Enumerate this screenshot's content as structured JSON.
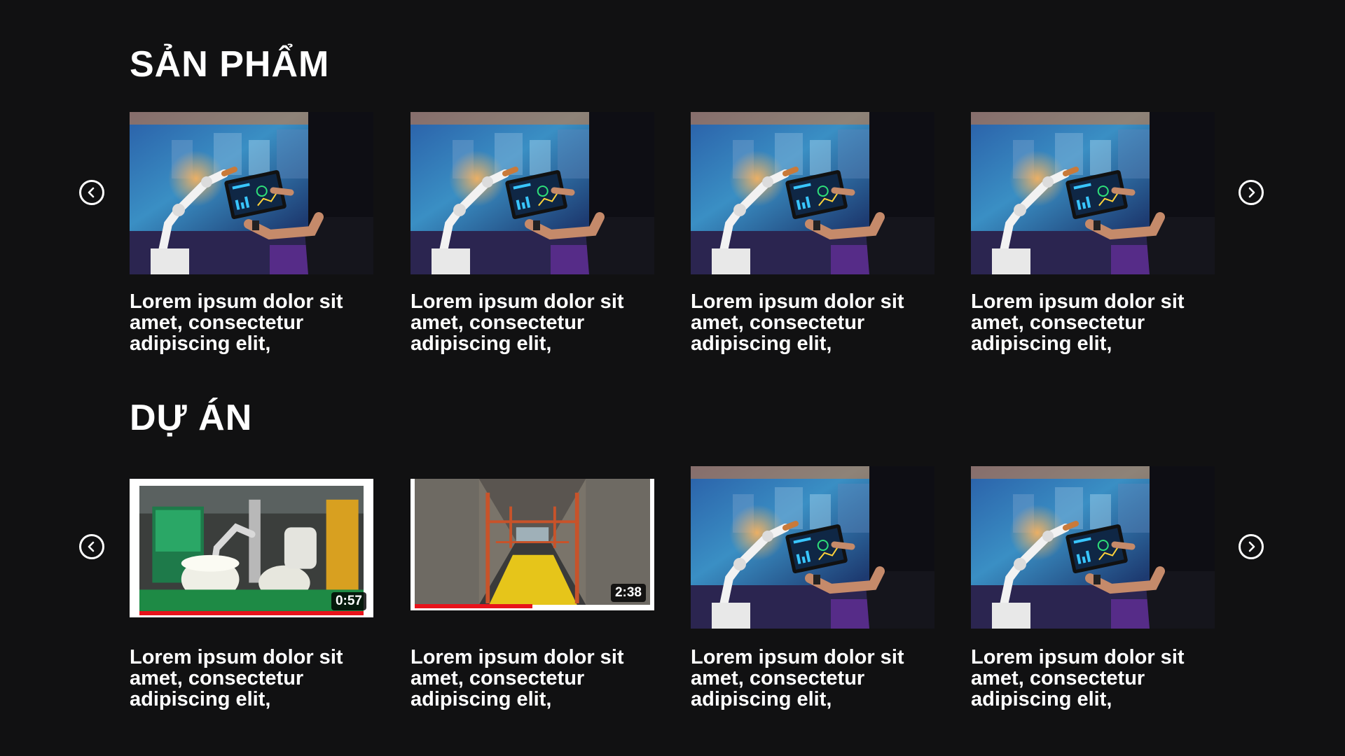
{
  "sections": [
    {
      "title": "SẢN PHẨM",
      "cards": [
        {
          "caption": "Lorem ipsum dolor sit amet, consectetur adipiscing elit,",
          "image": "robot-arm-tablet-photo"
        },
        {
          "caption": "Lorem ipsum dolor sit amet, consectetur adipiscing elit,",
          "image": "robot-arm-tablet-photo"
        },
        {
          "caption": "Lorem ipsum dolor sit amet, consectetur adipiscing elit,",
          "image": "robot-arm-tablet-photo"
        },
        {
          "caption": "Lorem ipsum dolor sit amet, consectetur adipiscing elit,",
          "image": "robot-arm-tablet-photo"
        }
      ]
    },
    {
      "title": "DỰ ÁN",
      "cards": [
        {
          "caption": "Lorem ipsum dolor sit amet, consectetur adipiscing elit,",
          "image": "factory-robot-video",
          "duration": "0:57",
          "progress": 1.0
        },
        {
          "caption": "Lorem ipsum dolor sit amet, consectetur adipiscing elit,",
          "image": "warehouse-aisle-video",
          "duration": "2:38",
          "progress": 0.5
        },
        {
          "caption": "Lorem ipsum dolor sit amet, consectetur adipiscing elit,",
          "image": "robot-arm-tablet-photo"
        },
        {
          "caption": "Lorem ipsum dolor sit amet, consectetur adipiscing elit,",
          "image": "robot-arm-tablet-photo"
        }
      ]
    }
  ],
  "icons": {
    "prev": "chevron-left-circle-icon",
    "next": "chevron-right-circle-icon"
  },
  "colors": {
    "background": "#111112",
    "text": "#ffffff",
    "progress": "#e8131b"
  }
}
